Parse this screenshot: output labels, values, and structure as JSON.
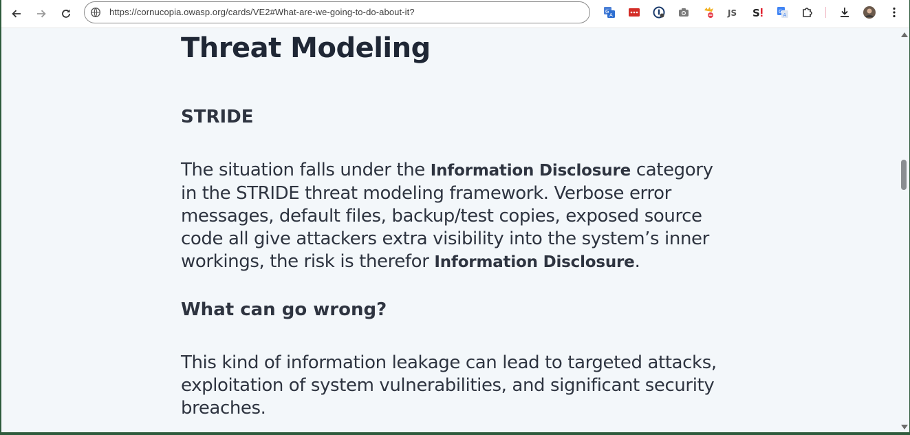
{
  "browser": {
    "url": "https://cornucopia.owasp.org/cards/VE2#What-are-we-going-to-do-about-it?",
    "nav_icons": [
      "back-icon",
      "forward-icon",
      "reload-icon"
    ],
    "extension_icons": [
      "translate-icon",
      "lastpass-icon",
      "one-password-icon",
      "camera-icon",
      "cookie-icon",
      "js-icon",
      "s-bang-icon",
      "google-translate-icon",
      "puzzle-icon"
    ],
    "toolbar_icons": [
      "download-icon",
      "profile-avatar",
      "kebab-menu-icon"
    ]
  },
  "page": {
    "title": "Threat Modeling",
    "sections": [
      {
        "heading": "STRIDE",
        "paragraph": {
          "t1": "The situation falls under the ",
          "b1": "Information Disclosure",
          "t2": " category in the STRIDE threat modeling framework. Verbose error messages, default files, backup/test copies, exposed source code all give attackers extra visibility into the system’s inner workings, the risk is therefor ",
          "b2": "Information Disclosure",
          "t3": "."
        }
      },
      {
        "heading": "What can go wrong?",
        "paragraph": {
          "t1": "This kind of information leakage can lead to targeted attacks, exploitation of system vulnerabilities, and significant security breaches."
        }
      }
    ]
  },
  "colors": {
    "page_background": "#f3f7fa",
    "text": "#2e3440",
    "title": "#1f2735"
  }
}
